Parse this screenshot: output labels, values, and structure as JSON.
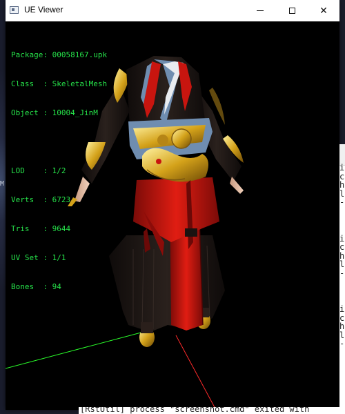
{
  "window": {
    "title": "UE Viewer"
  },
  "info": {
    "package": "Package: 00058167.upk",
    "class": "Class  : SkeletalMesh",
    "object": "Object : 10004_JinM",
    "lod": "LOD    : 1/2",
    "verts": "Verts  : 6723",
    "tris": "Tris   : 9644",
    "uvset": "UV Set : 1/1",
    "bones": "Bones  : 94"
  },
  "colors": {
    "info_text": "#26e34a",
    "titlebar": "#ffffff",
    "viewport_bg": "#000000",
    "axis_x": "#ff2a2a",
    "axis_y": "#2aff2a",
    "robe_black": "#1c1614",
    "robe_red": "#c8150f",
    "gold": "#d4a21a",
    "trim_blue": "#6f8db0"
  },
  "console": {
    "lines": [
      "i",
      "c",
      "h",
      "l",
      "-",
      "i",
      "c",
      "h",
      "l",
      "-",
      "i",
      "c",
      "h",
      "l",
      "-"
    ],
    "bottom_line": "[RstUtil] process \"screenshot.cmd\" exited with"
  },
  "desktop": {
    "fragment": "M"
  },
  "icons": [
    "app-icon",
    "minimize-icon",
    "maximize-icon",
    "close-icon"
  ]
}
